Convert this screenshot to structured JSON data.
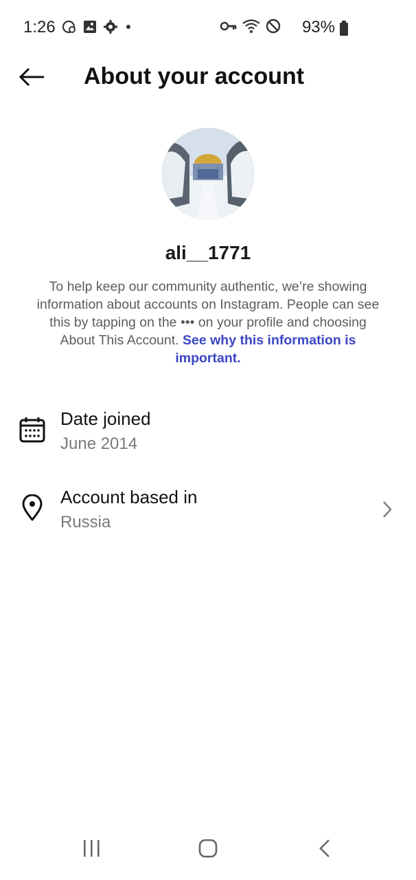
{
  "status_bar": {
    "time": "1:26",
    "battery_percent": "93%",
    "icons_left": [
      "data-saver-icon",
      "gallery-icon",
      "settings-icon",
      "dot-icon"
    ],
    "icons_right": [
      "vpn-key-icon",
      "wifi-icon",
      "do-not-disturb-icon",
      "battery-icon"
    ]
  },
  "header": {
    "title": "About your account",
    "back_icon": "arrow-left-icon"
  },
  "profile": {
    "username": "ali__1771",
    "description_text": "To help keep our community authentic, we’re showing information about accounts on Instagram. People can see this by tapping on the ••• on your profile and choosing About This Account.",
    "link_text": "See why this information is important."
  },
  "rows": [
    {
      "label": "Date joined",
      "value": "June 2014",
      "icon": "calendar-icon",
      "has_chevron": false
    },
    {
      "label": "Account based in",
      "value": "Russia",
      "icon": "location-pin-icon",
      "has_chevron": true
    }
  ],
  "nav_bar": {
    "buttons": [
      "recents-icon",
      "home-icon",
      "back-icon"
    ]
  },
  "colors": {
    "link": "#3a47c4",
    "text_primary": "#111111",
    "text_secondary": "#7a7a7a",
    "background": "#ffffff"
  }
}
